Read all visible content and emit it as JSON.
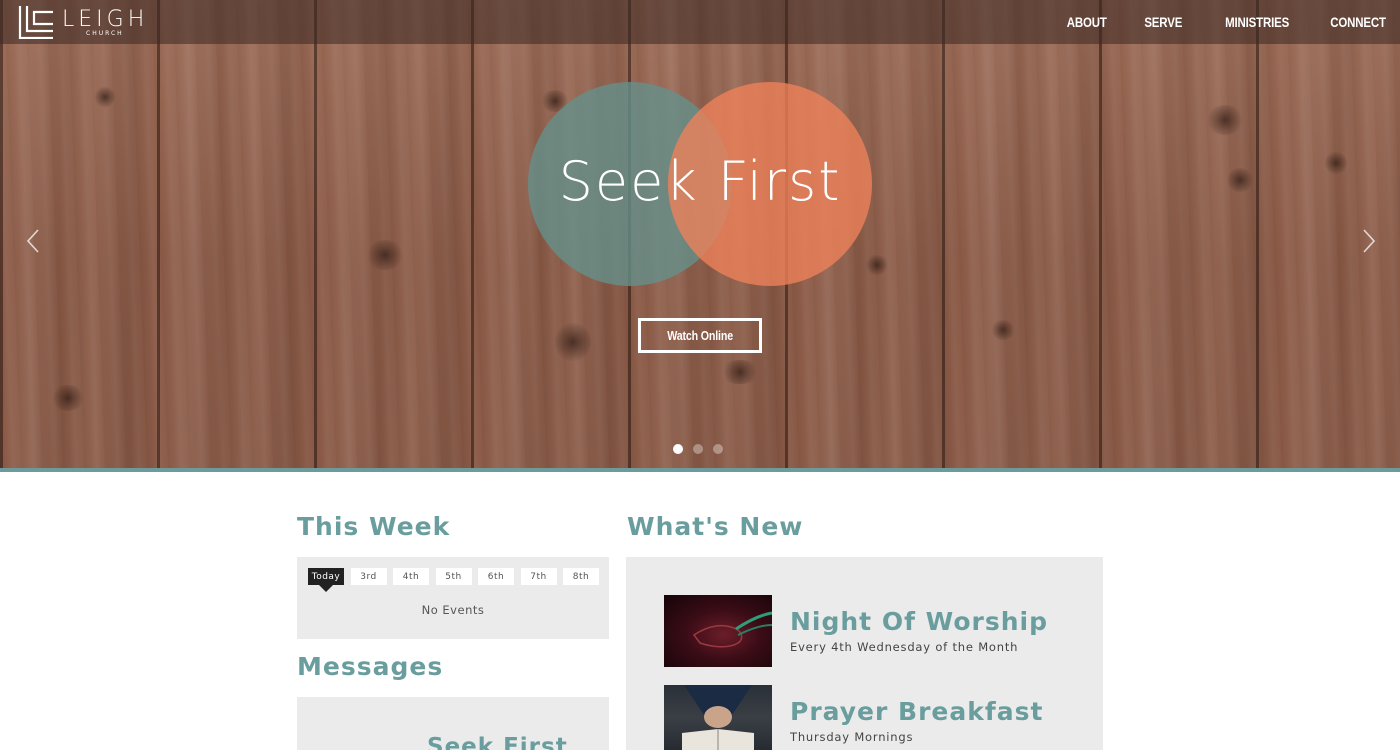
{
  "header": {
    "logo": {
      "name": "LEIGH",
      "sub": "CHURCH"
    },
    "nav": [
      {
        "label": "ABOUT"
      },
      {
        "label": "SERVE"
      },
      {
        "label": "MINISTRIES"
      },
      {
        "label": "CONNECT"
      }
    ]
  },
  "hero": {
    "title": "Seek First",
    "button_label": "Watch Online",
    "slides": 3,
    "active_slide": 1,
    "colors": {
      "teal_circle": "#64918c",
      "orange_circle": "#f0825a",
      "accent_border": "#6d9b9c"
    }
  },
  "this_week": {
    "title": "This Week",
    "days": [
      "Today",
      "3rd",
      "4th",
      "5th",
      "6th",
      "7th",
      "8th"
    ],
    "selected_day": "Today",
    "empty_text": "No Events"
  },
  "messages": {
    "title": "Messages",
    "latest_title": "Seek First"
  },
  "whats_new": {
    "title": "What's New",
    "items": [
      {
        "title": "Night Of Worship",
        "subtitle": "Every 4th Wednesday of the Month"
      },
      {
        "title": "Prayer Breakfast",
        "subtitle": "Thursday Mornings"
      }
    ]
  },
  "colors": {
    "accent": "#6a9d9e",
    "panel_bg": "#ebebeb"
  }
}
